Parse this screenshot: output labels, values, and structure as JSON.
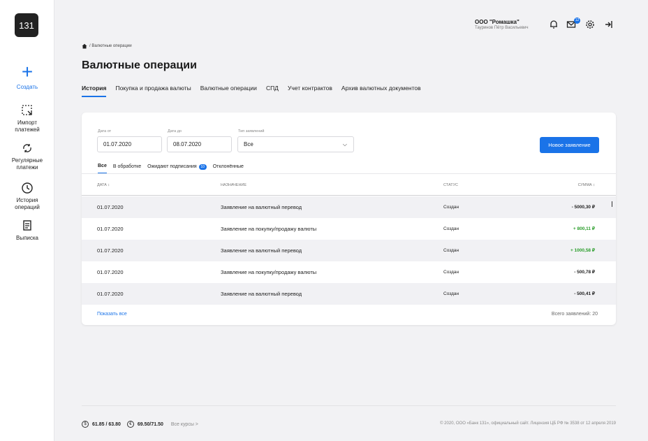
{
  "sidebar": {
    "logo": "131",
    "items": [
      {
        "label": "Создать",
        "icon": "plus-icon"
      },
      {
        "label": "Импорт\nплатежей",
        "icon": "import-icon"
      },
      {
        "label": "Регулярные\nплатежи",
        "icon": "repeat-icon"
      },
      {
        "label": "История\nопераций",
        "icon": "clock-icon"
      },
      {
        "label": "Выписка",
        "icon": "document-icon"
      }
    ]
  },
  "header": {
    "company": "ООО \"Ромашка\"",
    "user": "Тауринов Пётр Васильевич",
    "mail_badge": "12",
    "breadcrumb": "/ Валютные операции",
    "title": "Валютные операции"
  },
  "tabs": [
    "История",
    "Покупка и продажа валюты",
    "Валютные операции",
    "СПД",
    "Учет контрактов",
    "Архив валютных документов"
  ],
  "filters": {
    "date_from_label": "Дата от",
    "date_from": "01.07.2020",
    "date_to_label": "Дата до",
    "date_to": "08.07.2020",
    "type_label": "Тип заявлений",
    "type_value": "Все",
    "new_button": "Новое заявление"
  },
  "subtabs": {
    "all": "Все",
    "processing": "В обработке",
    "awaiting": "Ожидают подписания",
    "awaiting_count": "10",
    "rejected": "Отклонённые"
  },
  "table": {
    "headers": {
      "date": "ДАТА ↕",
      "purpose": "НАЗНАЧЕНИЕ",
      "status": "СТАТУС",
      "sum": "СУММА ↕"
    },
    "rows": [
      {
        "date": "01.07.2020",
        "purpose": "Заявление на валютный перевод",
        "status": "Создан",
        "sum": "- 5000,30 ₽"
      },
      {
        "date": "01.07.2020",
        "purpose": "Заявление на покупку/продажу валюты",
        "status": "Создан",
        "sum": "+ 800,11 ₽"
      },
      {
        "date": "01.07.2020",
        "purpose": "Заявление на валютный перевод",
        "status": "Создан",
        "sum": "+ 1000,58 ₽"
      },
      {
        "date": "01.07.2020",
        "purpose": "Заявление на покупку/продажу валюты",
        "status": "Создан",
        "sum": "- 500,78 ₽"
      },
      {
        "date": "01.07.2020",
        "purpose": "Заявление на валютный перевод",
        "status": "Создан",
        "sum": "- 500,41 ₽"
      }
    ],
    "show_all": "Показать все",
    "total": "Всего заявлений: 20"
  },
  "footer": {
    "usd_symbol": "$",
    "usd_rate": "61.85 / 63.80",
    "eur_symbol": "€",
    "eur_rate": "69.50/71.50",
    "all_rates": "Все курсы >",
    "copyright": "© 2020, ООО «Банк 131», официальный сайт. Лицензия ЦБ РФ № 3538 от 12 апреля 2019"
  },
  "colors": {
    "accent": "#1a73e8",
    "positive": "#2a9d2a"
  }
}
